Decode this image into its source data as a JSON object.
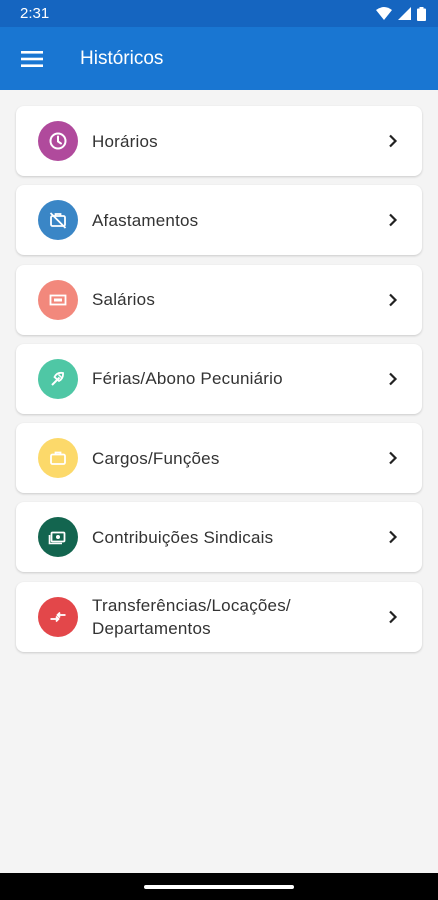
{
  "status_bar": {
    "time": "2:31"
  },
  "app_bar": {
    "title": "Históricos"
  },
  "items": [
    {
      "label": "Horários",
      "icon": "clock-icon",
      "color": "#b04a9c"
    },
    {
      "label": "Afastamentos",
      "icon": "briefcase-off-icon",
      "color": "#3a86c6"
    },
    {
      "label": "Salários",
      "icon": "money-icon",
      "color": "#f2887c"
    },
    {
      "label": "Férias/Abono Pecuniário",
      "icon": "beach-umbrella-icon",
      "color": "#4fc7a5"
    },
    {
      "label": "Cargos/Funções",
      "icon": "briefcase-icon",
      "color": "#fcd96a"
    },
    {
      "label": "Contribuições Sindicais",
      "icon": "cash-icon",
      "color": "#13654f"
    },
    {
      "label": "Transferências/Locações/ Departamentos",
      "icon": "transfer-icon",
      "color": "#e3474a"
    }
  ]
}
